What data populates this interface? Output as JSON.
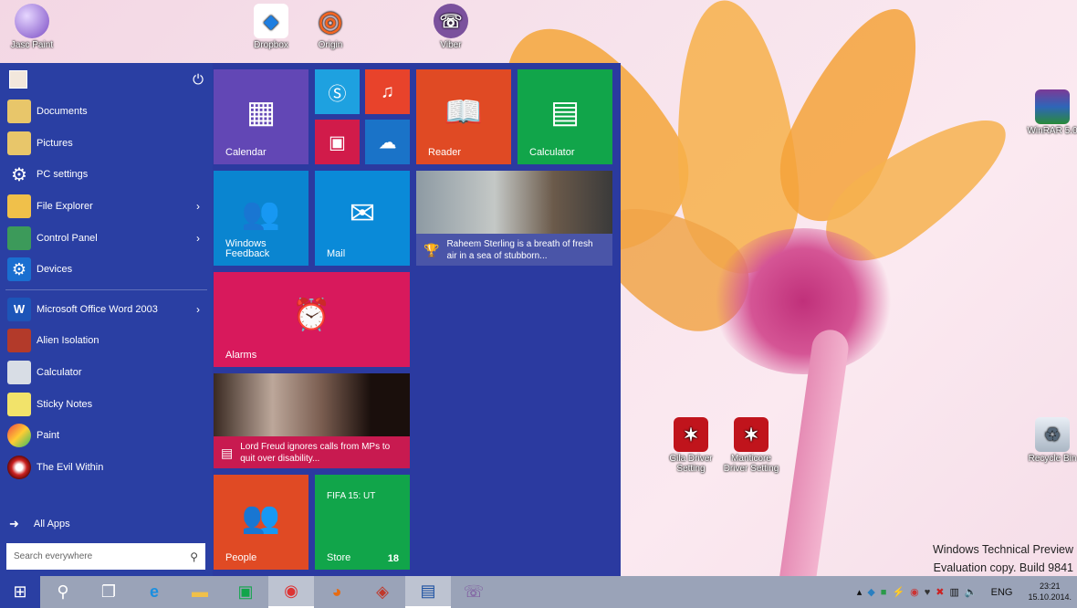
{
  "desktop": {
    "icons": [
      {
        "label": "Jasc Paint"
      },
      {
        "label": "Dropbox"
      },
      {
        "label": "Origin"
      },
      {
        "label": "Viber"
      },
      {
        "label": "WinRAR 5.0"
      },
      {
        "label": "Gila Driver Setting"
      },
      {
        "label": "Manticore Driver Setting"
      },
      {
        "label": "Recycle Bin"
      }
    ],
    "watermark": {
      "line1": "Windows Technical Preview",
      "line2": "Evaluation copy. Build 9841"
    }
  },
  "start_menu": {
    "left_items": [
      {
        "label": "Documents"
      },
      {
        "label": "Pictures"
      },
      {
        "label": "PC settings"
      },
      {
        "label": "File Explorer"
      },
      {
        "label": "Control Panel"
      },
      {
        "label": "Devices"
      },
      {
        "label": "Microsoft Office Word 2003"
      },
      {
        "label": "Alien Isolation"
      },
      {
        "label": "Calculator"
      },
      {
        "label": "Sticky Notes"
      },
      {
        "label": "Paint"
      },
      {
        "label": "The Evil Within"
      }
    ],
    "all_apps": "All Apps",
    "search_placeholder": "Search everywhere",
    "tiles": {
      "calendar": "Calendar",
      "reader": "Reader",
      "calculator": "Calculator",
      "windows_feedback": "Windows Feedback",
      "mail": "Mail",
      "news1": "Raheem Sterling is a breath of fresh air in a sea of stubborn...",
      "alarms": "Alarms",
      "news2": "Lord Freud ignores calls from MPs to quit over disability...",
      "people": "People",
      "store": "Store",
      "store_app": "FIFA 15: UT",
      "store_count": "18"
    }
  },
  "taskbar": {
    "language": "ENG",
    "time": "23:21",
    "date": "15.10.2014."
  }
}
